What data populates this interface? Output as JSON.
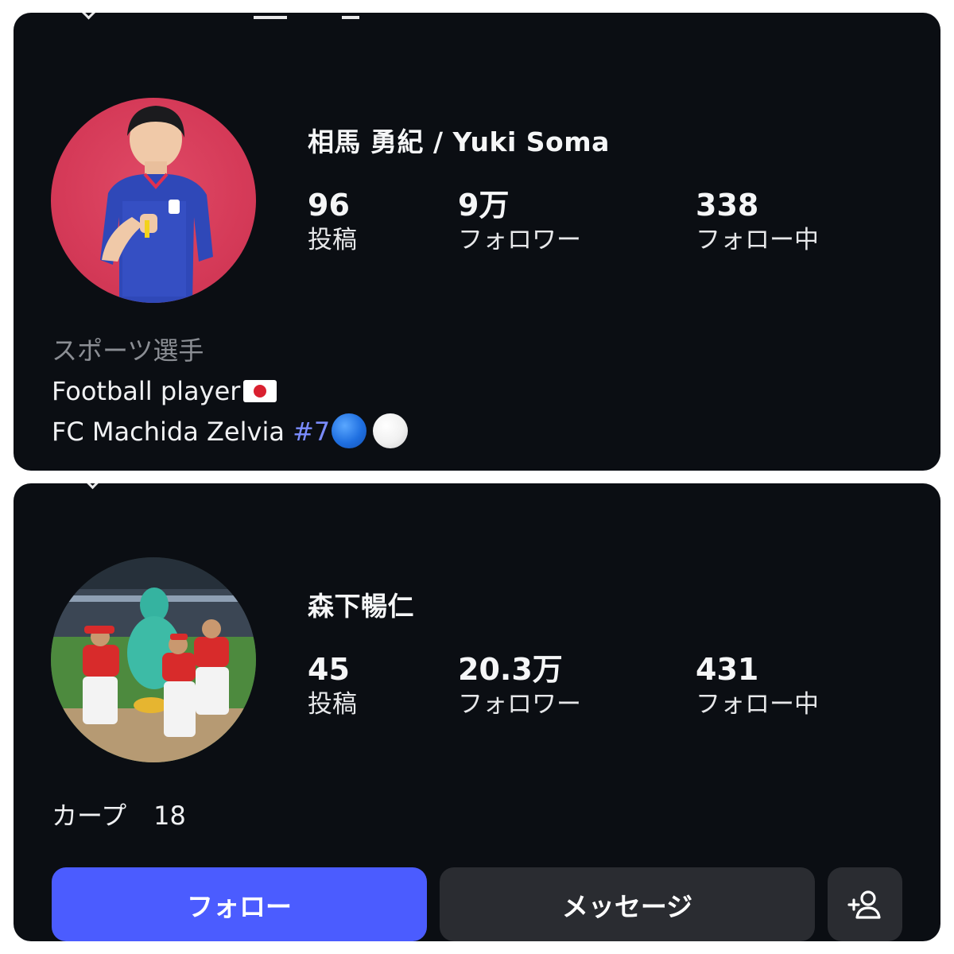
{
  "profiles": [
    {
      "name": "相馬 勇紀 / Yuki Soma",
      "stats": [
        {
          "value": "96",
          "label": "投稿"
        },
        {
          "value": "9万",
          "label": "フォロワー"
        },
        {
          "value": "338",
          "label": "フォロー中"
        }
      ],
      "bio": {
        "category": "スポーツ選手",
        "line1": "Football player",
        "line2_text": "FC Machida Zelvia ",
        "line2_hashtag": "#7"
      }
    },
    {
      "name": "森下暢仁",
      "stats": [
        {
          "value": "45",
          "label": "投稿"
        },
        {
          "value": "20.3万",
          "label": "フォロワー"
        },
        {
          "value": "431",
          "label": "フォロー中"
        }
      ],
      "bio": {
        "text": "カープ",
        "number": "18"
      },
      "buttons": {
        "follow": "フォロー",
        "message": "メッセージ",
        "add_icon": "person-add-icon"
      }
    }
  ],
  "colors": {
    "background": "#0b0e13",
    "accent": "#4b5cff",
    "hashtag": "#7b8cff",
    "secondary_button": "#2a2c31"
  }
}
